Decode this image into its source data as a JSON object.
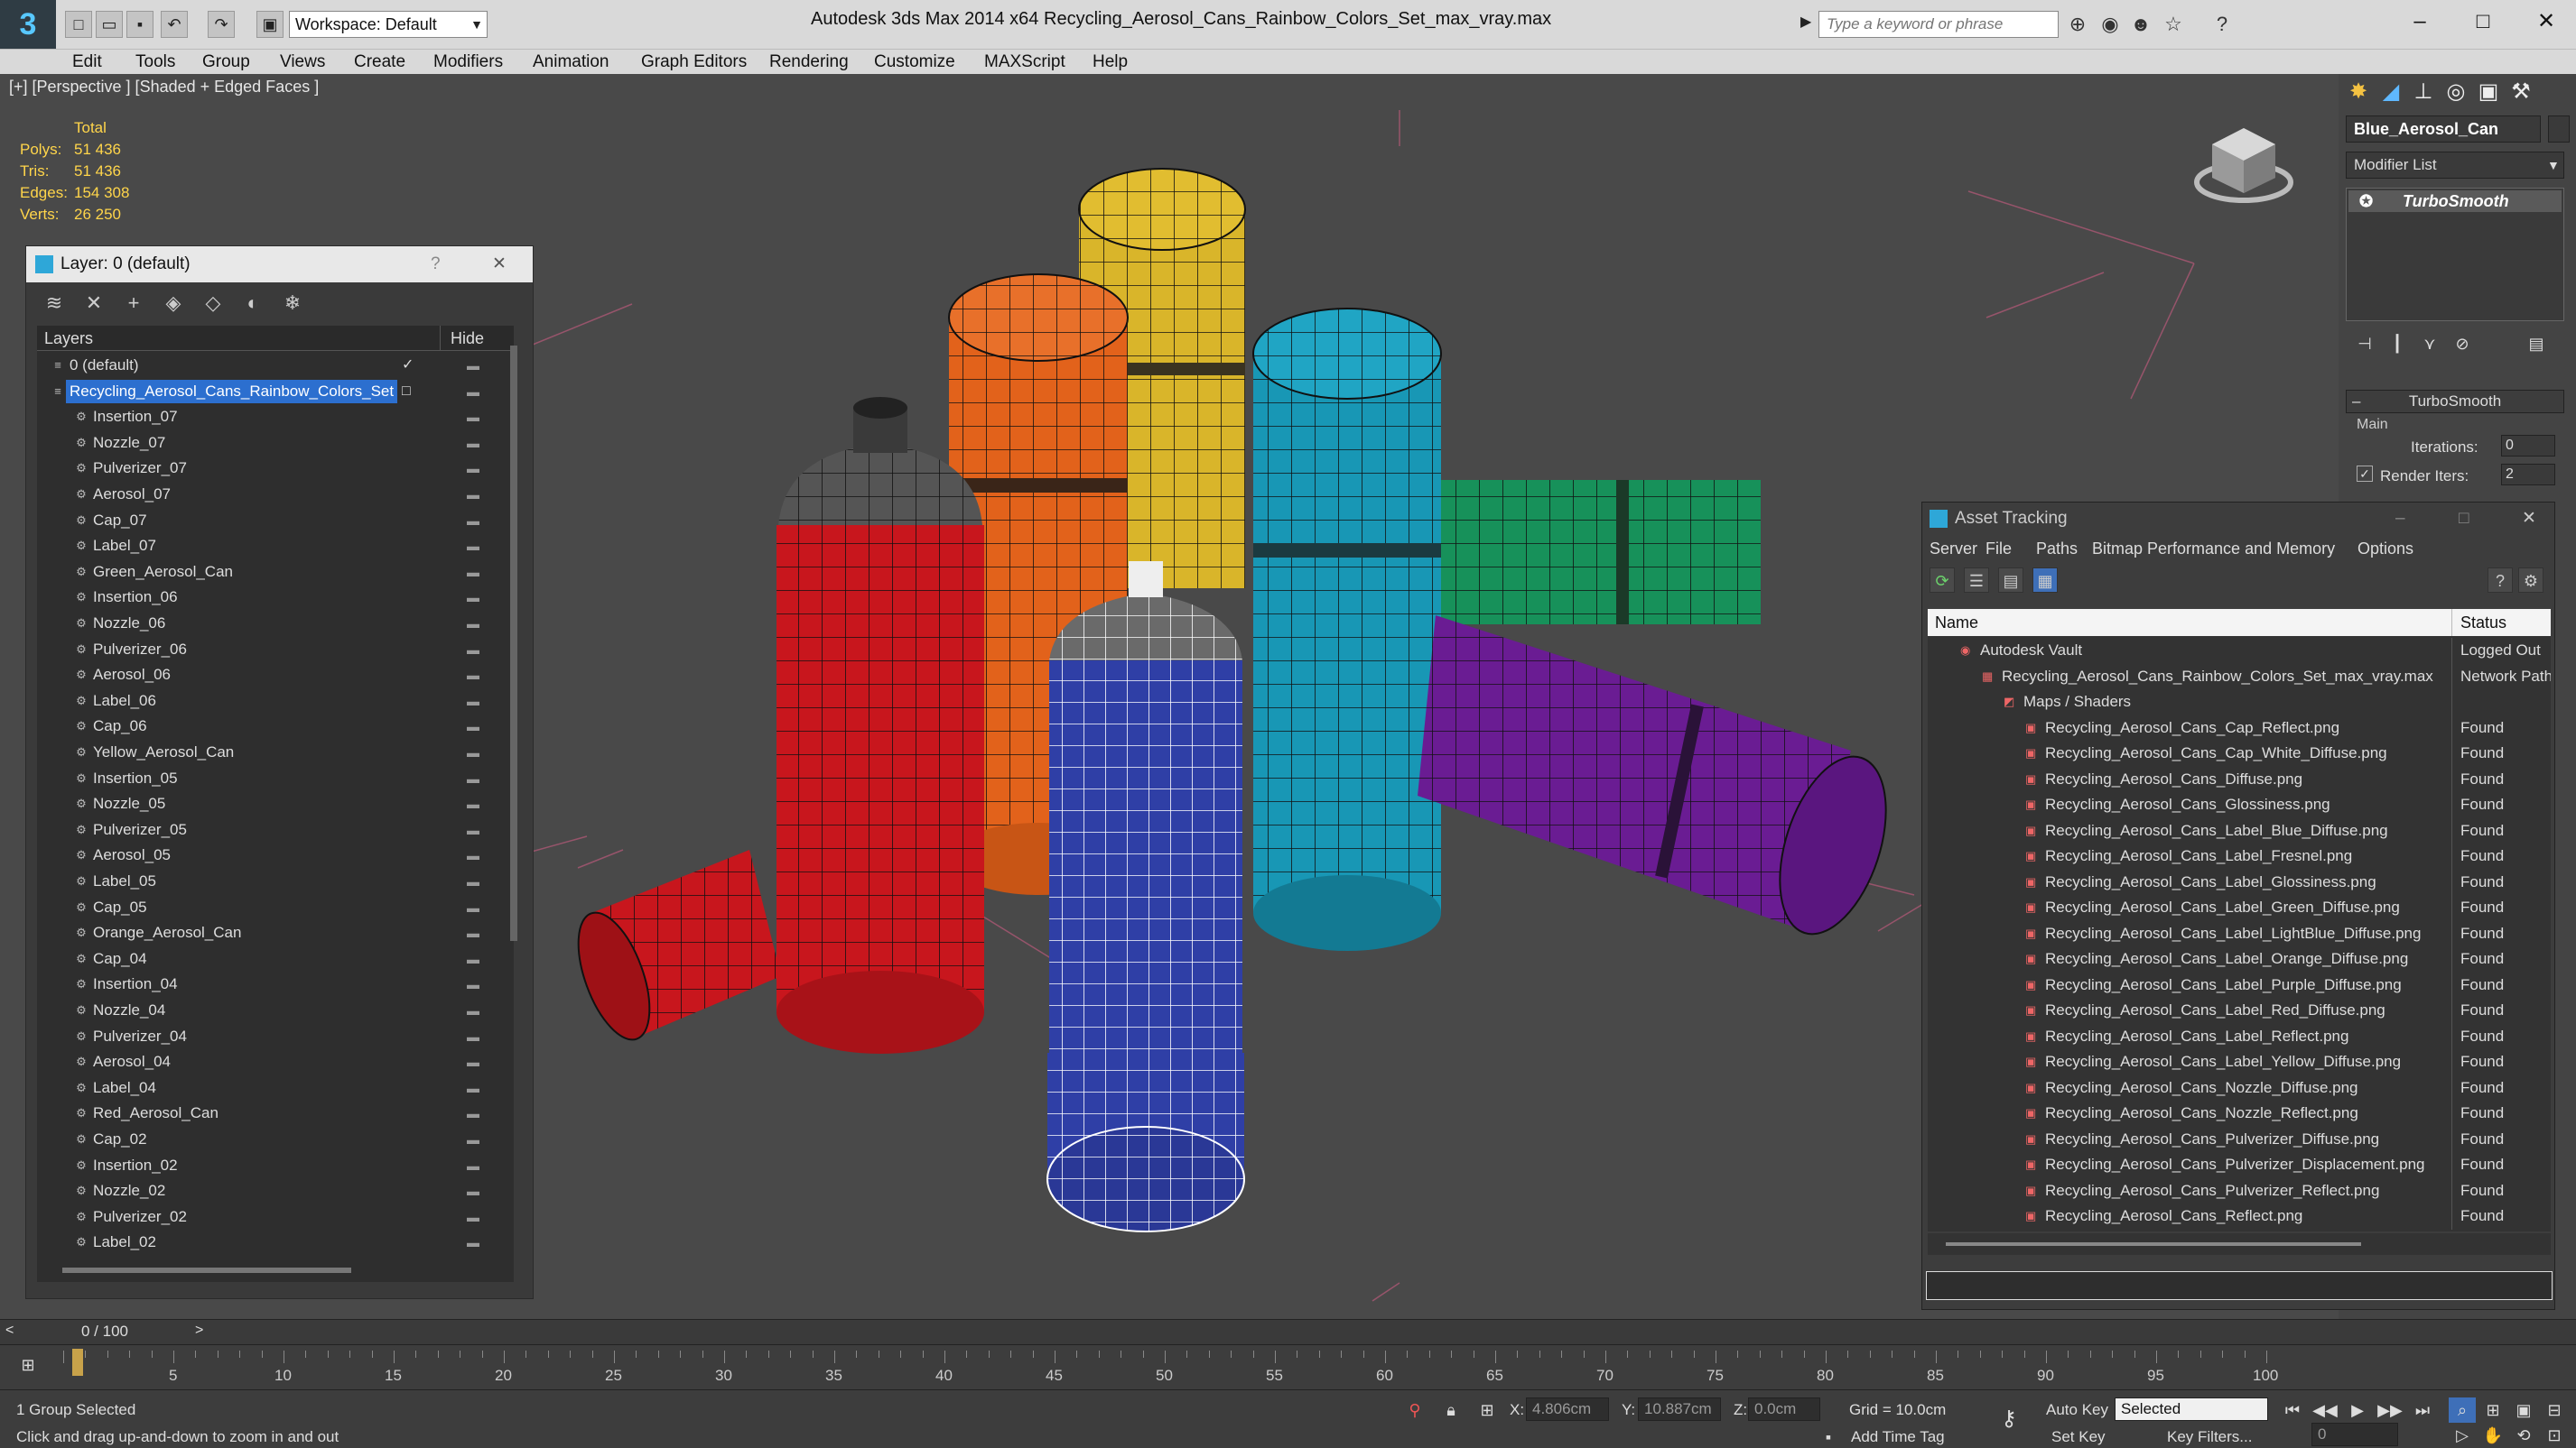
{
  "titlebar": {
    "workspace": "Workspace: Default",
    "app_title": "Autodesk 3ds Max  2014 x64",
    "doc_title": "Recycling_Aerosol_Cans_Rainbow_Colors_Set_max_vray.max",
    "search_placeholder": "Type a keyword or phrase"
  },
  "menubar": [
    "Edit",
    "Tools",
    "Group",
    "Views",
    "Create",
    "Modifiers",
    "Animation",
    "Graph Editors",
    "Rendering",
    "Customize",
    "MAXScript",
    "Help"
  ],
  "viewport": {
    "label": "[+] [Perspective ] [Shaded + Edged Faces ]",
    "stats": {
      "header": "Total",
      "rows": [
        {
          "k": "Polys:",
          "v": "51 436"
        },
        {
          "k": "Tris:",
          "v": "51 436"
        },
        {
          "k": "Edges:",
          "v": "154 308"
        },
        {
          "k": "Verts:",
          "v": "26 250"
        }
      ]
    }
  },
  "layer_panel": {
    "title": "Layer: 0 (default)",
    "help": "?",
    "close": "✕",
    "col_layers": "Layers",
    "col_hide": "Hide",
    "default_layer": "0 (default)",
    "selected_layer": "Recycling_Aerosol_Cans_Rainbow_Colors_Set",
    "objects": [
      "Insertion_07",
      "Nozzle_07",
      "Pulverizer_07",
      "Aerosol_07",
      "Cap_07",
      "Label_07",
      "Green_Aerosol_Can",
      "Insertion_06",
      "Nozzle_06",
      "Pulverizer_06",
      "Aerosol_06",
      "Label_06",
      "Cap_06",
      "Yellow_Aerosol_Can",
      "Insertion_05",
      "Nozzle_05",
      "Pulverizer_05",
      "Aerosol_05",
      "Label_05",
      "Cap_05",
      "Orange_Aerosol_Can",
      "Cap_04",
      "Insertion_04",
      "Nozzle_04",
      "Pulverizer_04",
      "Aerosol_04",
      "Label_04",
      "Red_Aerosol_Can",
      "Cap_02",
      "Insertion_02",
      "Nozzle_02",
      "Pulverizer_02",
      "Label_02"
    ]
  },
  "command_panel": {
    "object_name": "Blue_Aerosol_Can",
    "modifier_list": "Modifier List",
    "stack_item": "TurboSmooth",
    "rollout_title": "TurboSmooth",
    "main_label": "Main",
    "iterations_label": "Iterations:",
    "iterations_value": "0",
    "render_iters_label": "Render Iters:",
    "render_iters_value": "2"
  },
  "asset_tracking": {
    "title": "Asset Tracking",
    "menus": [
      "Server",
      "File",
      "Paths",
      "Bitmap Performance and Memory",
      "Options"
    ],
    "col_name": "Name",
    "col_status": "Status",
    "vault": {
      "name": "Autodesk Vault",
      "status": "Logged Out"
    },
    "file": {
      "name": "Recycling_Aerosol_Cans_Rainbow_Colors_Set_max_vray.max",
      "status": "Network Path"
    },
    "maps_group": "Maps / Shaders",
    "maps": [
      {
        "name": "Recycling_Aerosol_Cans_Cap_Reflect.png",
        "status": "Found"
      },
      {
        "name": "Recycling_Aerosol_Cans_Cap_White_Diffuse.png",
        "status": "Found"
      },
      {
        "name": "Recycling_Aerosol_Cans_Diffuse.png",
        "status": "Found"
      },
      {
        "name": "Recycling_Aerosol_Cans_Glossiness.png",
        "status": "Found"
      },
      {
        "name": "Recycling_Aerosol_Cans_Label_Blue_Diffuse.png",
        "status": "Found"
      },
      {
        "name": "Recycling_Aerosol_Cans_Label_Fresnel.png",
        "status": "Found"
      },
      {
        "name": "Recycling_Aerosol_Cans_Label_Glossiness.png",
        "status": "Found"
      },
      {
        "name": "Recycling_Aerosol_Cans_Label_Green_Diffuse.png",
        "status": "Found"
      },
      {
        "name": "Recycling_Aerosol_Cans_Label_LightBlue_Diffuse.png",
        "status": "Found"
      },
      {
        "name": "Recycling_Aerosol_Cans_Label_Orange_Diffuse.png",
        "status": "Found"
      },
      {
        "name": "Recycling_Aerosol_Cans_Label_Purple_Diffuse.png",
        "status": "Found"
      },
      {
        "name": "Recycling_Aerosol_Cans_Label_Red_Diffuse.png",
        "status": "Found"
      },
      {
        "name": "Recycling_Aerosol_Cans_Label_Reflect.png",
        "status": "Found"
      },
      {
        "name": "Recycling_Aerosol_Cans_Label_Yellow_Diffuse.png",
        "status": "Found"
      },
      {
        "name": "Recycling_Aerosol_Cans_Nozzle_Diffuse.png",
        "status": "Found"
      },
      {
        "name": "Recycling_Aerosol_Cans_Nozzle_Reflect.png",
        "status": "Found"
      },
      {
        "name": "Recycling_Aerosol_Cans_Pulverizer_Diffuse.png",
        "status": "Found"
      },
      {
        "name": "Recycling_Aerosol_Cans_Pulverizer_Displacement.png",
        "status": "Found"
      },
      {
        "name": "Recycling_Aerosol_Cans_Pulverizer_Reflect.png",
        "status": "Found"
      },
      {
        "name": "Recycling_Aerosol_Cans_Reflect.png",
        "status": "Found"
      }
    ]
  },
  "timeline": {
    "frame_label": "0 / 100",
    "ticks": [
      "5",
      "10",
      "15",
      "20",
      "25",
      "30",
      "35",
      "40",
      "45",
      "50",
      "55",
      "60",
      "65",
      "70",
      "75",
      "80",
      "85",
      "90",
      "95",
      "100"
    ]
  },
  "statusbar": {
    "selection": "1 Group Selected",
    "prompt": "Click and drag up-and-down to zoom in and out",
    "x_label": "X:",
    "x_value": "4.806cm",
    "y_label": "Y:",
    "y_value": "10.887cm",
    "z_label": "Z:",
    "z_value": "0.0cm",
    "grid": "Grid = 10.0cm",
    "add_time_tag": "Add Time Tag",
    "auto_key": "Auto Key",
    "set_key": "Set Key",
    "selected": "Selected",
    "key_filters": "Key Filters...",
    "frame": "0"
  },
  "colors": {
    "selection": "#2c6fcf",
    "stats": "#ffd54a",
    "can_red": "#c8161d",
    "can_orange": "#e2621b",
    "can_yellow": "#d9b52a",
    "can_blue": "#2f3fa6",
    "can_cyan": "#1897b5",
    "can_green": "#17915a",
    "can_purple": "#6a1c93"
  }
}
